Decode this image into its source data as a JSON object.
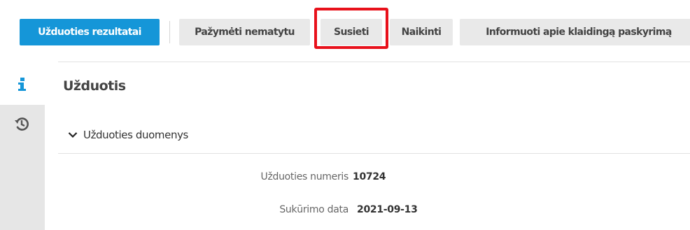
{
  "toolbar": {
    "primary_label": "Užduoties rezultatai",
    "mark_unseen_label": "Pažymėti nematytu",
    "link_label": "Susieti",
    "delete_label": "Naikinti",
    "report_label": "Informuoti apie klaidingą paskyrimą"
  },
  "sidebar": {
    "info_icon": "info-icon",
    "history_icon": "history-icon"
  },
  "main": {
    "title": "Užduotis",
    "section": {
      "label": "Užduoties duomenys",
      "fields": [
        {
          "label": "Užduoties numeris",
          "value": "10724"
        },
        {
          "label": "Sukūrimo data",
          "value": "2021-09-13"
        }
      ]
    }
  },
  "colors": {
    "primary": "#1596d8",
    "button_bg": "#e9e9e9",
    "highlight": "#e8111b",
    "sidebar_bg": "#e6e6e6"
  }
}
